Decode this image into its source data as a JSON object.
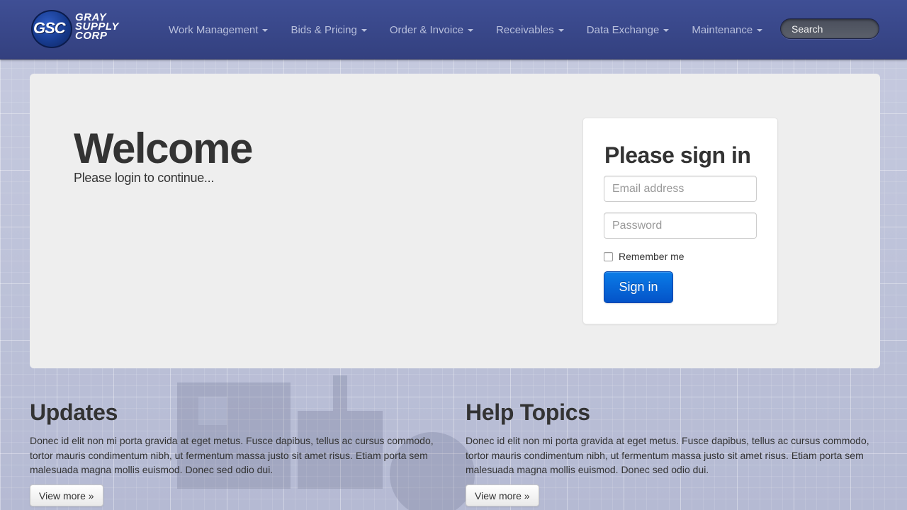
{
  "brand": {
    "logo_mark": "GSC",
    "logo_lines": [
      "GRAY",
      "SUPPLY",
      "CORP"
    ]
  },
  "nav": {
    "items": [
      {
        "label": "Work Management"
      },
      {
        "label": "Bids & Pricing"
      },
      {
        "label": "Order & Invoice"
      },
      {
        "label": "Receivables"
      },
      {
        "label": "Data Exchange"
      },
      {
        "label": "Maintenance"
      }
    ],
    "search_placeholder": "Search"
  },
  "hero": {
    "title": "Welcome",
    "subtitle": "Please login to continue..."
  },
  "signin": {
    "title": "Please sign in",
    "email_placeholder": "Email address",
    "password_placeholder": "Password",
    "remember_label": "Remember me",
    "remember_checked": false,
    "button_label": "Sign in"
  },
  "sections": {
    "updates": {
      "title": "Updates",
      "body": "Donec id elit non mi porta gravida at eget metus. Fusce dapibus, tellus ac cursus commodo, tortor mauris condimentum nibh, ut fermentum massa justo sit amet risus. Etiam porta sem malesuada magna mollis euismod. Donec sed odio dui.",
      "button_label": "View more »"
    },
    "help": {
      "title": "Help Topics",
      "body": "Donec id elit non mi porta gravida at eget metus. Fusce dapibus, tellus ac cursus commodo, tortor mauris condimentum nibh, ut fermentum massa justo sit amet risus. Etiam porta sem malesuada magna mollis euismod. Donec sed odio dui.",
      "button_label": "View more »"
    }
  },
  "colors": {
    "navbar": "#3a4888",
    "primary_button": "#0a6ad8",
    "hero_background": "#eeeeee"
  }
}
